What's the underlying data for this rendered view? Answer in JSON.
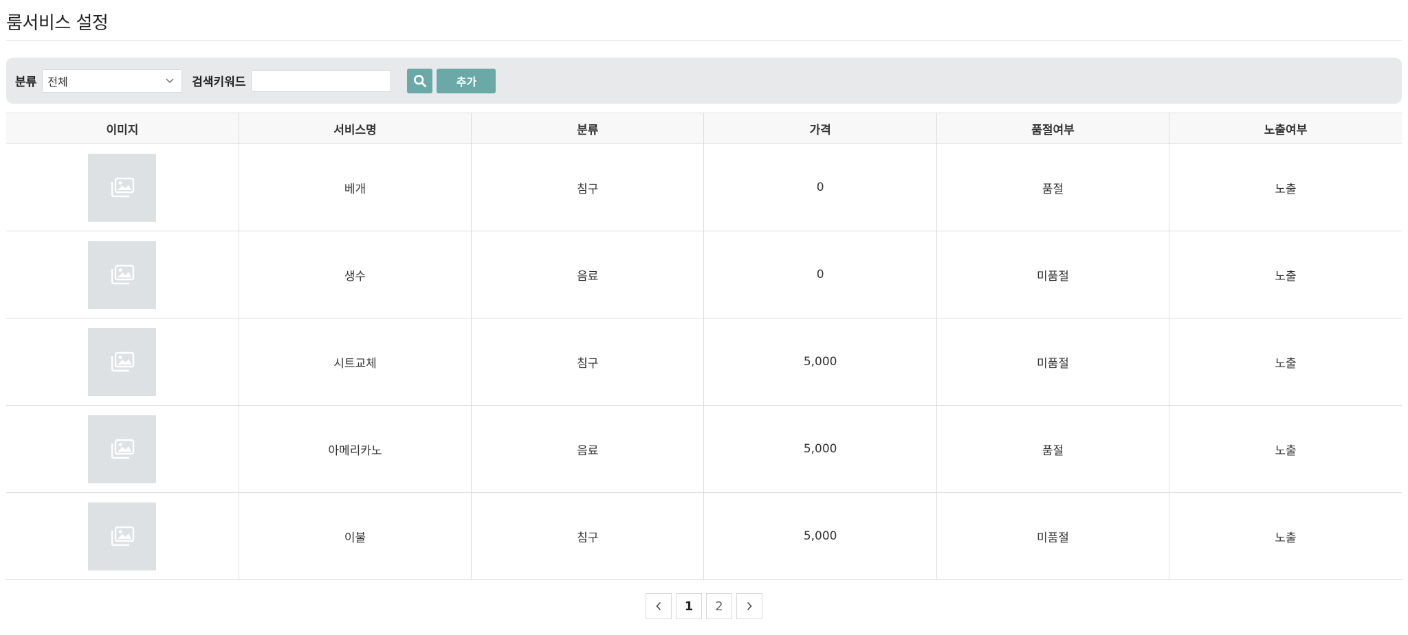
{
  "page": {
    "title": "룸서비스 설정"
  },
  "filters": {
    "category_label": "분류",
    "category_value": "전체",
    "keyword_label": "검색키워드",
    "keyword_value": "",
    "keyword_placeholder": "",
    "search_icon": "search-icon",
    "add_label": "추가"
  },
  "table": {
    "headers": [
      "이미지",
      "서비스명",
      "분류",
      "가격",
      "품절여부",
      "노출여부"
    ],
    "rows": [
      {
        "name": "베개",
        "category": "침구",
        "price": "0",
        "soldout": "품절",
        "visible": "노출"
      },
      {
        "name": "생수",
        "category": "음료",
        "price": "0",
        "soldout": "미품절",
        "visible": "노출"
      },
      {
        "name": "시트교체",
        "category": "침구",
        "price": "5,000",
        "soldout": "미품절",
        "visible": "노출"
      },
      {
        "name": "아메리카노",
        "category": "음료",
        "price": "5,000",
        "soldout": "품절",
        "visible": "노출"
      },
      {
        "name": "이불",
        "category": "침구",
        "price": "5,000",
        "soldout": "미품절",
        "visible": "노출"
      }
    ]
  },
  "pagination": {
    "prev": "‹",
    "pages": [
      "1",
      "2"
    ],
    "current": "1",
    "next": "›"
  },
  "colors": {
    "accent": "#6aa9a8",
    "filter_bg": "#e8e9eb",
    "thumb_bg": "#dde1e4"
  }
}
